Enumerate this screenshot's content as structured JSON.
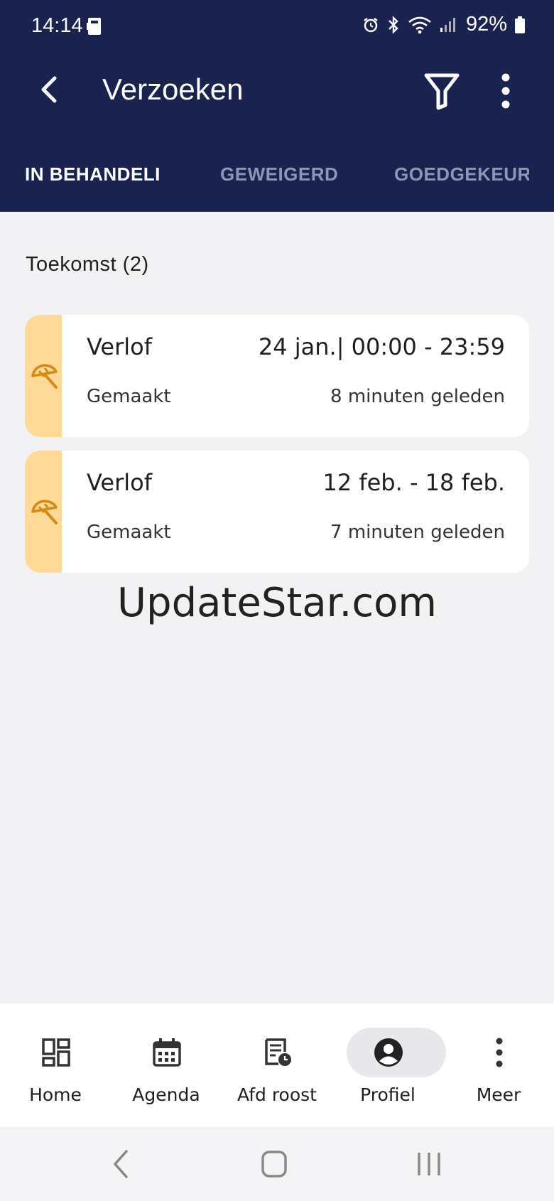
{
  "status_bar": {
    "time": "14:14",
    "battery": "92%",
    "icons": [
      "alarm-icon",
      "bluetooth-icon",
      "wifi-icon",
      "signal-icon",
      "battery-icon"
    ]
  },
  "header": {
    "title": "Verzoeken",
    "background_color": "#1a2350"
  },
  "tabs": [
    {
      "label": "IN BEHANDELI",
      "active": true
    },
    {
      "label": "GEWEIGERD",
      "active": false
    },
    {
      "label": "GOEDGEKEUR",
      "active": false
    }
  ],
  "section": {
    "title": "Toekomst (2)"
  },
  "requests": [
    {
      "type": "Verlof",
      "date": "24 jan.| 00:00 - 23:59",
      "status": "Gemaakt",
      "time_ago": "8 minuten geleden",
      "icon": "umbrella-icon"
    },
    {
      "type": "Verlof",
      "date": "12 feb. - 18 feb.",
      "status": "Gemaakt",
      "time_ago": "7 minuten geleden",
      "icon": "umbrella-icon"
    }
  ],
  "watermark": "UpdateStar.com",
  "bottom_nav": [
    {
      "label": "Home",
      "icon": "dashboard-icon",
      "active": false
    },
    {
      "label": "Agenda",
      "icon": "calendar-icon",
      "active": false
    },
    {
      "label": "Afd roost",
      "icon": "roster-icon",
      "active": false
    },
    {
      "label": "Profiel",
      "icon": "profile-icon",
      "active": true
    },
    {
      "label": "Meer",
      "icon": "more-vertical-icon",
      "active": false
    }
  ],
  "colors": {
    "accent_stripe": "#ffd998",
    "umbrella": "#d58a12"
  }
}
